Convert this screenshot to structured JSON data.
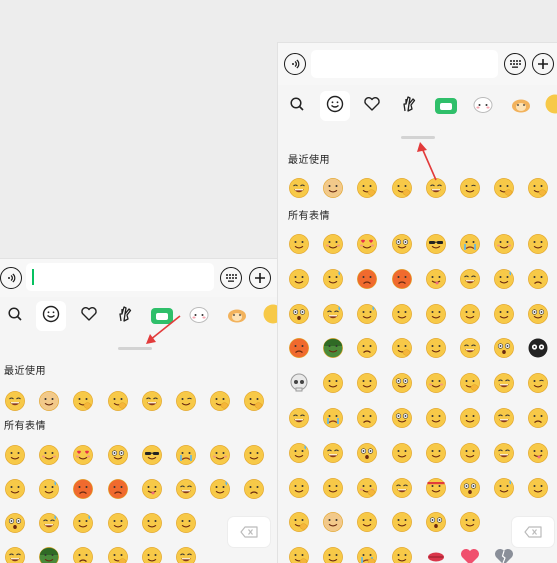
{
  "colors": {
    "emoji_face": "#f7c948",
    "emoji_outline": "#e0a020",
    "accent": "#07c160",
    "arrow": "#e23b3b"
  },
  "sections": {
    "recent": "最近使用",
    "all": "所有表情"
  },
  "toolbar_icons": {
    "voice": "voice-icon",
    "keyboard": "keyboard-icon",
    "add": "add-icon"
  },
  "tab_icons": [
    "search-icon",
    "smiley-icon",
    "heart-icon",
    "gesture-icon",
    "sticker-pack-icon",
    "sticker-cat-icon",
    "sticker-hamster-icon",
    "sticker-face-icon"
  ],
  "delete_icon": "backspace-icon",
  "left": {
    "recent": [
      "laugh-cry",
      "doge",
      "peek",
      "facepalm",
      "grin",
      "wink",
      "ok-hand",
      "smirk-hand"
    ],
    "all": [
      [
        "smile",
        "blush",
        "heart-eyes",
        "stare",
        "cool",
        "cry",
        "shy",
        "skeptical"
      ],
      [
        "sleepy",
        "awkward",
        "angry",
        "rage",
        "tongue",
        "grin",
        "sweat",
        "frown"
      ],
      [
        "surprised",
        "laugh-sweat",
        "nervous",
        "yawn",
        "smile",
        "sneer",
        "",
        ""
      ],
      [
        "grin",
        "army",
        "frustrated",
        "whisper",
        "scheming",
        "laugh",
        "",
        ""
      ]
    ]
  },
  "right": {
    "recent": [
      "laugh-cry",
      "doge",
      "peek",
      "facepalm",
      "grin",
      "wink",
      "ok-hand",
      "smirk-hand"
    ],
    "all": [
      [
        "smile",
        "blush",
        "heart-eyes",
        "stare",
        "cool",
        "cry",
        "shy",
        "skeptical"
      ],
      [
        "sleepy",
        "awkward",
        "angry",
        "rage",
        "tongue",
        "grin",
        "sweat",
        "frown"
      ],
      [
        "surprised",
        "laugh-sweat",
        "nervous",
        "yawn",
        "smile",
        "sneer",
        "tired",
        "dizzy"
      ],
      [
        "angry-red",
        "army",
        "frustrated",
        "whisper",
        "scheming",
        "laugh",
        "shocked",
        "panda"
      ],
      [
        "skull",
        "spy",
        "mask",
        "dizzy",
        "shy-smile",
        "hug",
        "grin-teeth",
        "wink-slide"
      ],
      [
        "cheer",
        "sob",
        "pout",
        "stare",
        "smirk",
        "starry",
        "grin",
        "sad"
      ],
      [
        "sweat-smile",
        "laugh",
        "shock",
        "dull",
        "smug",
        "sly",
        "cry-laugh",
        "mischief"
      ],
      [
        "smug",
        "smile",
        "blush-hand",
        "cheer",
        "headband",
        "wow",
        "sweat",
        "question"
      ],
      [
        "facepalm",
        "doge-2",
        "eyeroll",
        "smirk",
        "surprise",
        "smile",
        "",
        ""
      ],
      [
        "peek",
        "flower",
        "cry-hands",
        "sleepy-drool",
        "lips",
        "heart",
        "broken-heart",
        ""
      ]
    ]
  }
}
